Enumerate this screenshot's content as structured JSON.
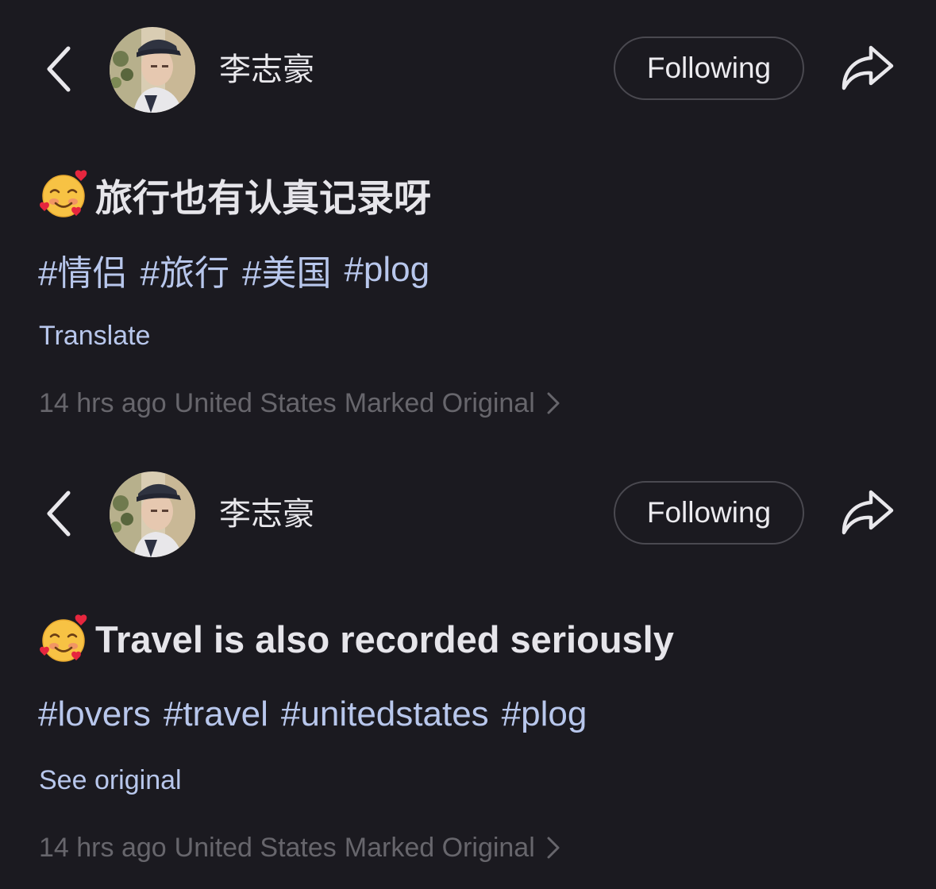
{
  "colors": {
    "background": "#1b1a20",
    "text_primary": "#e9e8ec",
    "link": "#b8c7ec",
    "meta_gray": "#67666c",
    "button_border": "#4a4950"
  },
  "posts": [
    {
      "username": "李志豪",
      "follow_label": "Following",
      "title_emoji": "smiling-face-with-hearts-icon",
      "title": "旅行也有认真记录呀",
      "tags": [
        "#情侣",
        "#旅行",
        "#美国",
        "#plog"
      ],
      "action_link": "Translate",
      "meta": {
        "time": "14 hrs ago",
        "location": "United States",
        "label": "Marked Original"
      }
    },
    {
      "username": "李志豪",
      "follow_label": "Following",
      "title_emoji": "smiling-face-with-hearts-icon",
      "title": "Travel is also recorded seriously",
      "tags": [
        "#lovers",
        "#travel",
        "#unitedstates",
        "#plog"
      ],
      "action_link": "See original",
      "meta": {
        "time": "14 hrs ago",
        "location": "United States",
        "label": "Marked Original"
      }
    }
  ]
}
